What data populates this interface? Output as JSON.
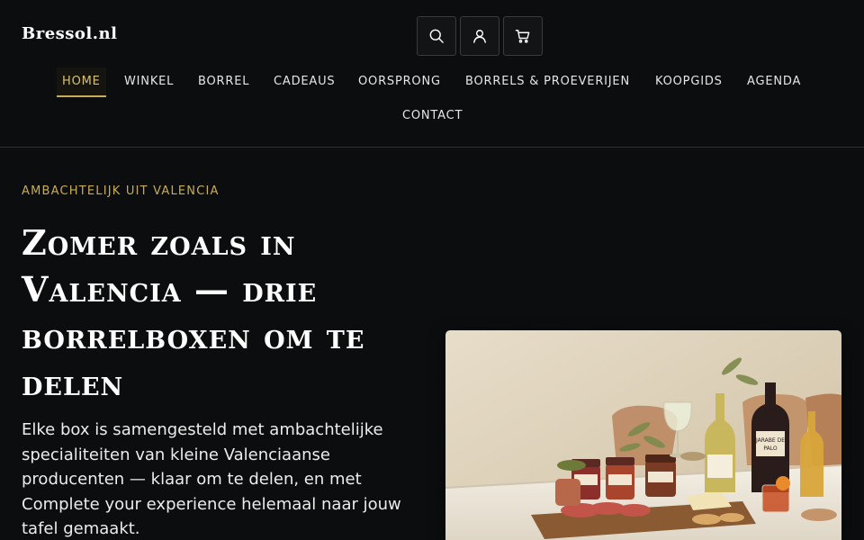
{
  "header": {
    "logo": "Bressol.nl",
    "icons": {
      "search": "search-icon",
      "account": "user-icon",
      "cart": "cart-icon"
    }
  },
  "nav": {
    "items": [
      {
        "label": "HOME",
        "active": true
      },
      {
        "label": "WINKEL"
      },
      {
        "label": "BORREL"
      },
      {
        "label": "CADEAUS"
      },
      {
        "label": "OORSPRONG"
      },
      {
        "label": "BORRELS & PROEVERIJEN"
      },
      {
        "label": "KOOPGIDS"
      },
      {
        "label": "AGENDA"
      },
      {
        "label": "CONTACT"
      }
    ]
  },
  "hero": {
    "eyebrow": "AMBACHTELIJK UIT VALENCIA",
    "title": "Zomer zoals in Valencia — drie borrelboxen om te delen",
    "text": "Elke box is samengesteld met ambachtelijke specialiteiten van kleine Valenciaanse producenten — klaar om te delen, en met Complete your experience helemaal naar jouw tafel gemaakt.",
    "bottle_label": "JARABE DE PALO"
  },
  "colors": {
    "background": "#0b0d0e",
    "accent": "#c8ad55",
    "text": "#ffffff"
  }
}
